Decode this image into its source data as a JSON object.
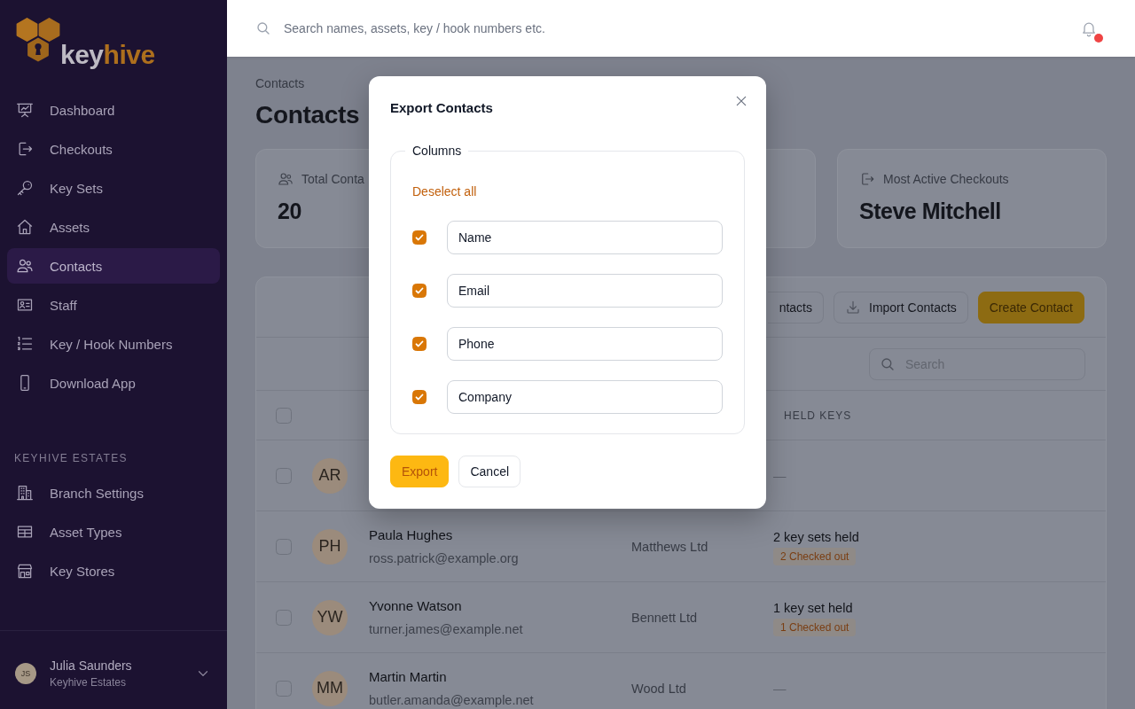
{
  "sidebar": {
    "logo": {
      "wordmark": [
        "key",
        "hive"
      ]
    },
    "nav_items": [
      {
        "label": "Dashboard",
        "selected": false
      },
      {
        "label": "Checkouts",
        "selected": false
      },
      {
        "label": "Key Sets",
        "selected": false
      },
      {
        "label": "Assets",
        "selected": false
      },
      {
        "label": "Contacts",
        "selected": true
      },
      {
        "label": "Staff",
        "selected": false
      },
      {
        "label": "Key / Hook Numbers",
        "selected": false
      },
      {
        "label": "Download App",
        "selected": false
      }
    ],
    "section": {
      "title": "KEYHIVE ESTATES",
      "items": [
        {
          "label": "Branch Settings",
          "selected": false
        },
        {
          "label": "Asset Types",
          "selected": false
        },
        {
          "label": "Key Stores",
          "selected": false
        }
      ]
    },
    "user": {
      "initials": "JS",
      "name": "Julia Saunders",
      "organisation": "Keyhive Estates"
    }
  },
  "top_bar": {
    "search": {
      "placeholder": "Search names, assets, key / hook numbers etc."
    },
    "notifications": {
      "unread": true
    }
  },
  "page": {
    "breadcrumb": "Contacts",
    "title": "Contacts",
    "stats": [
      {
        "label": "Total Conta",
        "value": "20"
      },
      {
        "label": "Most Active Checkouts",
        "value": "Steve Mitchell"
      }
    ],
    "contacts_table": {
      "toolbar_buttons": [
        {
          "label": "ntacts",
          "kind": "plain"
        },
        {
          "label": "Import Contacts",
          "kind": "download"
        },
        {
          "label": "Create Contact",
          "kind": "primary"
        }
      ],
      "search": {
        "placeholder": "Search"
      },
      "header": {
        "checked": false,
        "held_keys": "HELD KEYS"
      },
      "rows": [
        {
          "selected": false,
          "initials": "AR",
          "held_keys": "—"
        },
        {
          "selected": false,
          "initials": "PH",
          "name": "Paula Hughes",
          "email": "ross.patrick@example.org",
          "company": "Matthews Ltd",
          "held_keys": "2 key sets held",
          "checked_out": "2 Checked out"
        },
        {
          "selected": false,
          "initials": "YW",
          "name": "Yvonne Watson",
          "email": "turner.james@example.net",
          "company": "Bennett Ltd",
          "held_keys": "1 key set held",
          "checked_out": "1 Checked out"
        },
        {
          "selected": false,
          "initials": "MM",
          "name": "Martin Martin",
          "email": "butler.amanda@example.net",
          "company": "Wood Ltd",
          "held_keys": "—"
        }
      ]
    }
  },
  "export_dialog": {
    "title": "Export Contacts",
    "group_label": "Columns",
    "deselect_all": "Deselect all",
    "columns": [
      {
        "value": "Name",
        "checked": true
      },
      {
        "value": "Email",
        "checked": true
      },
      {
        "value": "Phone",
        "checked": true
      },
      {
        "value": "Company",
        "checked": true
      }
    ],
    "buttons": [
      {
        "label": "Export",
        "kind": "primary"
      },
      {
        "label": "Cancel",
        "kind": "secondary"
      }
    ]
  }
}
